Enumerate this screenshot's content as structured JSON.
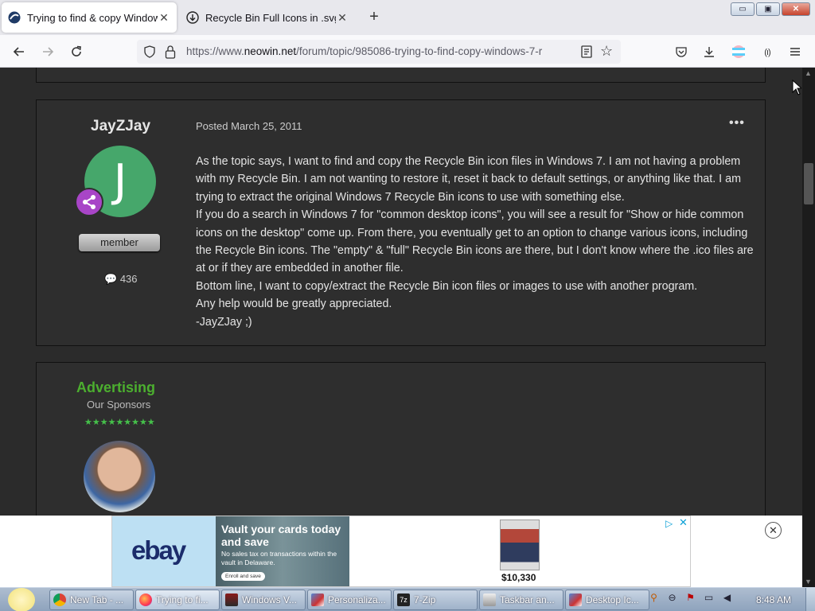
{
  "browser": {
    "tabs": [
      {
        "title": "Trying to find & copy Windows",
        "active": true,
        "icon": "neowin-icon"
      },
      {
        "title": "Recycle Bin Full Icons in .svg .p",
        "active": false,
        "icon": "download-icon"
      }
    ],
    "url": {
      "prefix": "https://www.",
      "domain": "neowin.net",
      "path": "/forum/topic/985086-trying-to-find-copy-windows-7-r"
    },
    "controls": {
      "minimize": "▭",
      "maximize": "▣",
      "close": "✕"
    }
  },
  "previous_post": {},
  "post": {
    "author": "JayZJay",
    "avatar_letter": "J",
    "rank": "member",
    "post_count": "436",
    "posted_label": "Posted",
    "posted_date": "March 25, 2011",
    "more": "•••",
    "body": [
      "As the topic says, I want to find and copy the Recycle Bin icon files in Windows 7. I am not having a problem with my Recycle Bin. I am not wanting to restore it, reset it back to default settings, or anything like that. I am trying to extract the original Windows 7 Recycle Bin icons to use with something else.",
      "If you do a search in Windows 7 for \"common desktop icons\", you will see a result for \"Show or hide common icons on the desktop\" come up. From there, you eventually get to an option to change various icons, including the Recycle Bin icons. The \"empty\" & \"full\" Recycle Bin icons are there, but I don't know where the .ico files are at or if they are embedded in another file.",
      "Bottom line, I want to copy/extract the Recycle Bin icon files or images to use with another program.",
      "Any help would be greatly appreciated.",
      "-JayZJay ;)"
    ],
    "colors": {
      "avatar": "#46a76b",
      "badge": "#a845c7"
    }
  },
  "advertising": {
    "title": "Advertising",
    "subtitle": "Our Sponsors",
    "stars": "★★★★★★★★★",
    "colors": {
      "title": "#4caf2f"
    }
  },
  "ad_banner": {
    "logo": "ebay",
    "headline": "Vault your cards today and save",
    "subtext": "No sales tax on transactions within the vault in Delaware.",
    "button": "Enroll and save",
    "price": "$10,330",
    "adchoices": "▷",
    "ad_x": "✕",
    "close": "✕"
  },
  "taskbar": {
    "items": [
      {
        "label": "New Tab - ...",
        "icon": "chrome-icon",
        "active": false
      },
      {
        "label": "Trying to fi...",
        "icon": "firefox-icon",
        "active": true
      },
      {
        "label": "Windows V...",
        "icon": "app-icon",
        "active": false
      },
      {
        "label": "Personaliza...",
        "icon": "personalization-icon",
        "active": false
      },
      {
        "label": "7-Zip",
        "icon": "7zip-icon",
        "active": false
      },
      {
        "label": "Taskbar an...",
        "icon": "taskbar-icon",
        "active": false
      },
      {
        "label": "Desktop Ic...",
        "icon": "desktop-icon",
        "active": false
      }
    ],
    "clock": "8:48 AM"
  }
}
